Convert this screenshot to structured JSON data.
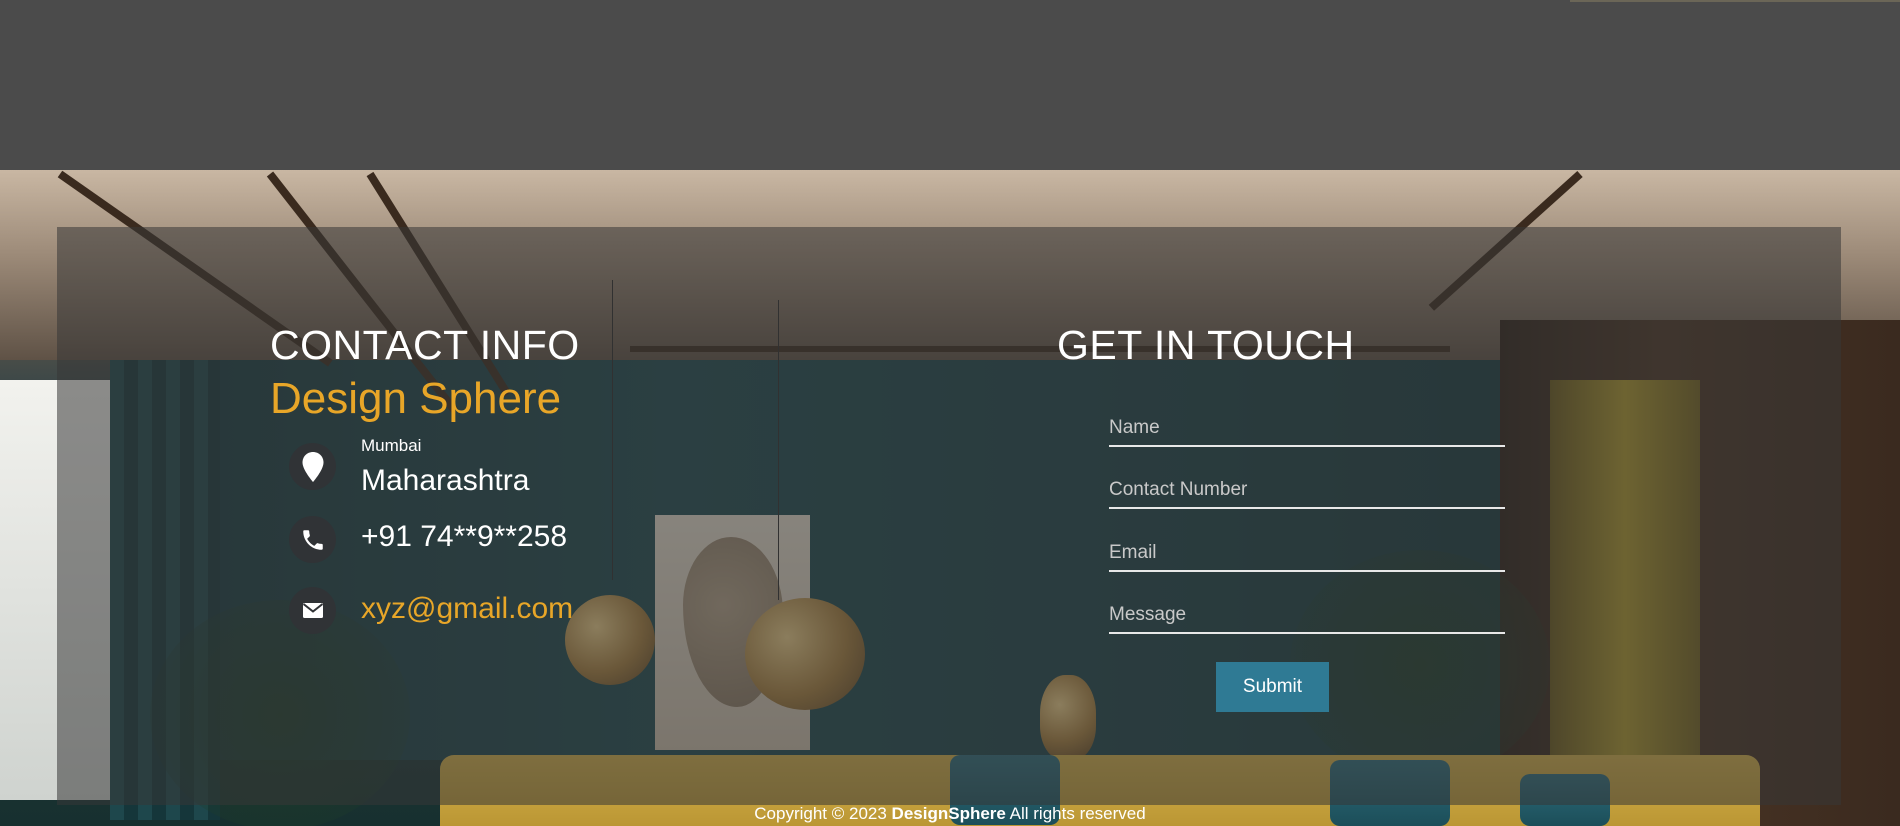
{
  "contact_info": {
    "heading": "CONTACT INFO",
    "brand": "Design Sphere",
    "city": "Mumbai",
    "state": "Maharashtra",
    "phone": "+91 74**9**258",
    "email": "xyz@gmail.com",
    "icons": {
      "location": "map-pin-icon",
      "phone": "phone-icon",
      "email": "envelope-icon"
    }
  },
  "get_in_touch": {
    "heading": "GET IN TOUCH",
    "fields": {
      "name_placeholder": "Name",
      "contact_placeholder": "Contact Number",
      "email_placeholder": "Email",
      "message_placeholder": "Message"
    },
    "submit_label": "Submit"
  },
  "footer": {
    "prefix": "Copyright © 2023",
    "brand": "DesignSphere",
    "suffix": "All rights reserved"
  },
  "colors": {
    "accent": "#e8a628",
    "button": "#2f7a94",
    "top_band": "#4b4b4b"
  }
}
